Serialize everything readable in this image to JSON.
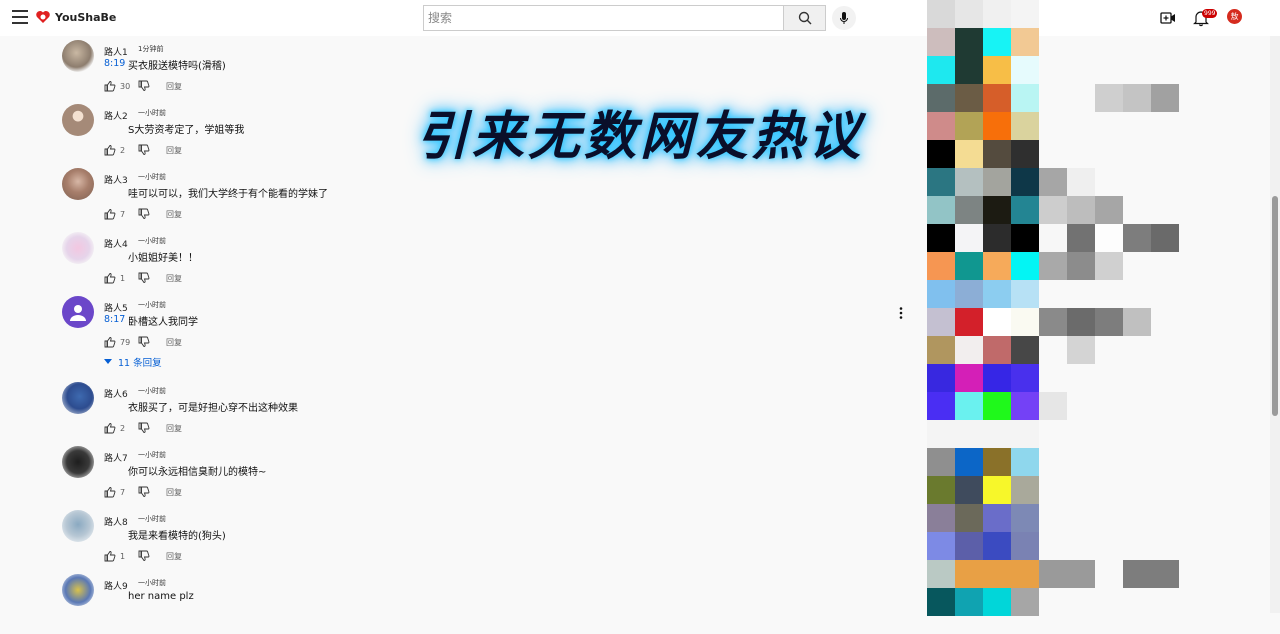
{
  "header": {
    "brand": "YouShaBe",
    "search_placeholder": "搜索",
    "notification_count": "999",
    "avatar_letter": "敖"
  },
  "overlay_caption": "引来无数网友热议",
  "reply_label": "回复",
  "comments": [
    {
      "author": "路人1",
      "time": "1分钟前",
      "timestamp": "8:19",
      "text": "买衣服送模特吗(滑稽)",
      "likes": "30"
    },
    {
      "author": "路人2",
      "time": "一小时前",
      "timestamp": "",
      "text": "S大劳资考定了，学姐等我",
      "likes": "2"
    },
    {
      "author": "路人3",
      "time": "一小时前",
      "timestamp": "",
      "text": "哇可以可以，我们大学终于有个能看的学妹了",
      "likes": "7"
    },
    {
      "author": "路人4",
      "time": "一小时前",
      "timestamp": "",
      "text": "小姐姐好美！！",
      "likes": "1"
    },
    {
      "author": "路人5",
      "time": "一小时前",
      "timestamp": "8:17",
      "text": "卧槽这人我同学",
      "likes": "79"
    },
    {
      "author": "路人6",
      "time": "一小时前",
      "timestamp": "",
      "text": "衣服买了，可是好担心穿不出这种效果",
      "likes": "2"
    },
    {
      "author": "路人7",
      "time": "一小时前",
      "timestamp": "",
      "text": "你可以永远相信臭耐儿的模特~",
      "likes": "7"
    },
    {
      "author": "路人8",
      "time": "一小时前",
      "timestamp": "",
      "text": "我是来看模特的(狗头)",
      "likes": "1"
    },
    {
      "author": "路人9",
      "time": "一小时前",
      "timestamp": "",
      "text": "her name plz",
      "likes": ""
    }
  ],
  "replies_toggle": "11 条回复",
  "colors": {
    "link_blue": "#065fd4",
    "caption_glow": "#29c7ff",
    "avatar_red": "#d52b1e"
  }
}
